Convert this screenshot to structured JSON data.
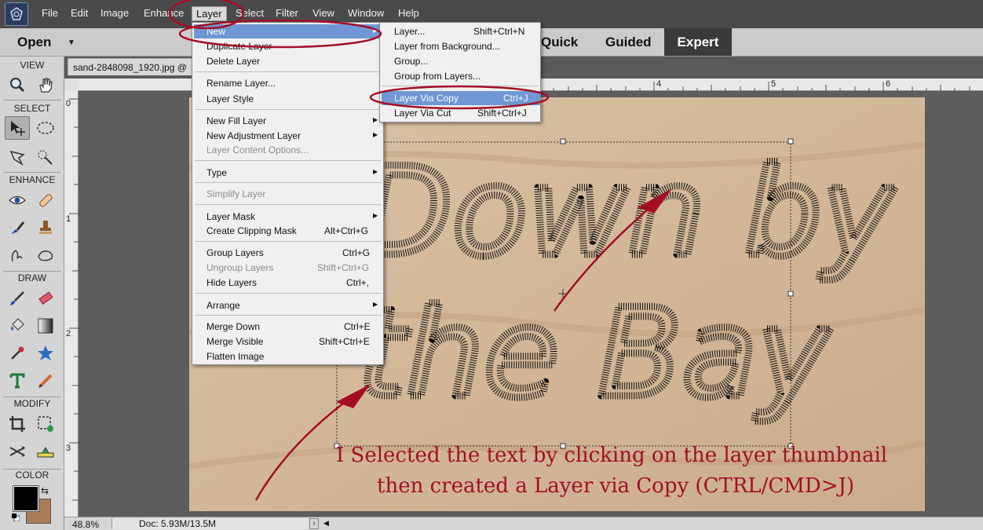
{
  "menubar": {
    "items": [
      "File",
      "Edit",
      "Image",
      "Enhance",
      "Layer",
      "Select",
      "Filter",
      "View",
      "Window",
      "Help"
    ],
    "active": "Layer"
  },
  "modebar": {
    "open_label": "Open",
    "tabs": [
      "Quick",
      "Guided",
      "Expert"
    ],
    "active_tab": "Expert"
  },
  "toolbox": {
    "sections": [
      "VIEW",
      "SELECT",
      "ENHANCE",
      "DRAW",
      "MODIFY",
      "COLOR"
    ],
    "foreground_color": "#000000",
    "background_color": "#a97c58"
  },
  "document": {
    "tab_title": "sand-2848098_1920.jpg @",
    "ruler_top": [
      "4",
      "5",
      "6"
    ],
    "ruler_left": [
      "0",
      "1",
      "2",
      "3"
    ],
    "photo_text": [
      "Down by",
      "the Bay"
    ]
  },
  "status": {
    "zoom": "48.8%",
    "doc_size": "Doc: 5.93M/13.5M"
  },
  "layer_menu": {
    "items": [
      {
        "label": "New",
        "submenu": true,
        "highlighted": true
      },
      {
        "label": "Duplicate Layer"
      },
      {
        "label": "Delete Layer"
      },
      {
        "label": "Rename Layer..."
      },
      {
        "label": "Layer Style"
      },
      {
        "label": "New Fill Layer",
        "submenu": true
      },
      {
        "label": "New Adjustment Layer",
        "submenu": true
      },
      {
        "label": "Layer Content Options...",
        "disabled": true
      },
      {
        "label": "Type",
        "submenu": true
      },
      {
        "label": "Simplify Layer",
        "disabled": true
      },
      {
        "label": "Layer Mask",
        "submenu": true
      },
      {
        "label": "Create Clipping Mask",
        "shortcut": "Alt+Ctrl+G"
      },
      {
        "label": "Group Layers",
        "shortcut": "Ctrl+G"
      },
      {
        "label": "Ungroup Layers",
        "shortcut": "Shift+Ctrl+G",
        "disabled": true
      },
      {
        "label": "Hide Layers",
        "shortcut": "Ctrl+,"
      },
      {
        "label": "Arrange",
        "submenu": true
      },
      {
        "label": "Merge Down",
        "shortcut": "Ctrl+E"
      },
      {
        "label": "Merge Visible",
        "shortcut": "Shift+Ctrl+E"
      },
      {
        "label": "Flatten Image"
      }
    ]
  },
  "new_submenu": {
    "items": [
      {
        "label": "Layer...",
        "shortcut": "Shift+Ctrl+N"
      },
      {
        "label": "Layer from Background..."
      },
      {
        "label": "Group..."
      },
      {
        "label": "Group from Layers..."
      },
      {
        "label": "Layer Via Copy",
        "shortcut": "Ctrl+J",
        "highlighted": true
      },
      {
        "label": "Layer Via Cut",
        "shortcut": "Shift+Ctrl+J"
      }
    ]
  },
  "annotation": {
    "caption_line1": "I Selected the text by clicking on the layer thumbnail",
    "caption_line2": "then created a Layer via Copy (CTRL/CMD>J)",
    "accent_color": "#a30e25"
  }
}
